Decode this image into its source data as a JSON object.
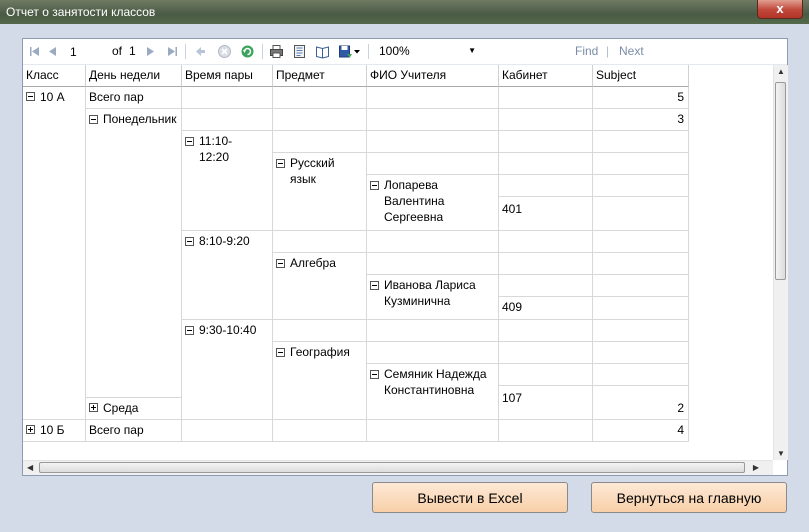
{
  "window": {
    "title": "Отчет о занятости классов",
    "close_glyph": "x"
  },
  "toolbar": {
    "page_value": "1",
    "of_label": "of",
    "total_pages": "1",
    "zoom_value": "100%",
    "find_label": "Find",
    "divider": "|",
    "next_label": "Next"
  },
  "table": {
    "headers": [
      "Класс",
      "День недели",
      "Время пары",
      "Предмет",
      "ФИО Учителя",
      "Кабинет",
      "Subject"
    ],
    "class_10a": "10 А",
    "class_10b": "10 Б",
    "total_label": "Всего пар",
    "total_label_2": "Всего пар",
    "total_10a": "5",
    "total_10b": "4",
    "monday": "Понедельник",
    "monday_total": "3",
    "wednesday": "Среда",
    "wednesday_total": "2",
    "time1": "11:10-12:20",
    "time2": "8:10-9:20",
    "time3": "9:30-10:40",
    "subject1": "Русский язык",
    "subject2": "Алгебра",
    "subject3": "География",
    "teacher1": "Лопарева Валентина Сергеевна",
    "teacher2": "Иванова Лариса Кузминична",
    "teacher3": "Семяник Надежда Константиновна",
    "room1": "401",
    "room2": "409",
    "room3": "107"
  },
  "buttons": {
    "export_excel": "Вывести в Excel",
    "back_main": "Вернуться на главную"
  },
  "colors": {
    "button_bg": "#f8cfa8",
    "window_bg": "#d3dbe8",
    "toolbar_icon": "#7a8ca8"
  }
}
